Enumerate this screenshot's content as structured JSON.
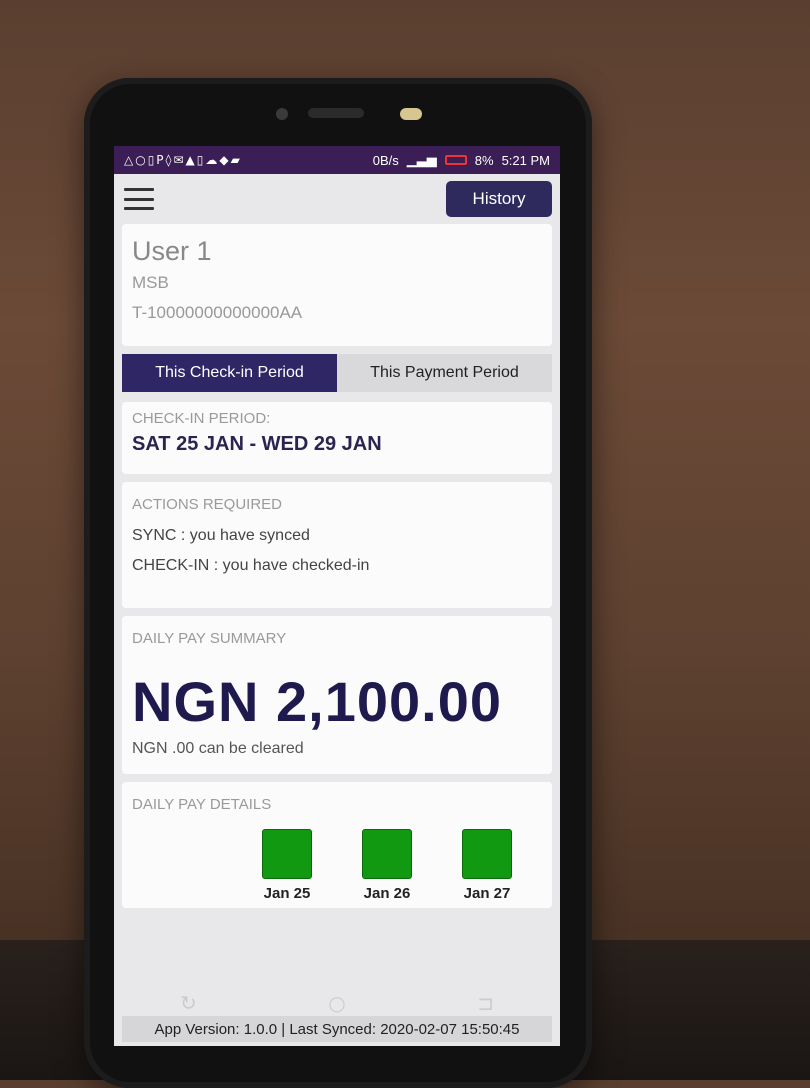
{
  "status_bar": {
    "network_speed": "0B/s",
    "battery": "8%",
    "time": "5:21 PM"
  },
  "header": {
    "history_label": "History"
  },
  "user": {
    "name": "User 1",
    "org": "MSB",
    "id": "T-10000000000000AA"
  },
  "tabs": [
    {
      "label": "This Check-in Period",
      "active": true
    },
    {
      "label": "This Payment Period",
      "active": false
    }
  ],
  "checkin": {
    "label": "CHECK-IN PERIOD:",
    "value": "SAT 25 JAN - WED 29 JAN"
  },
  "actions": {
    "label": "ACTIONS REQUIRED",
    "items": [
      "SYNC : you have synced",
      "CHECK-IN : you have checked-in"
    ]
  },
  "summary": {
    "label": "DAILY PAY SUMMARY",
    "amount": "NGN 2,100.00",
    "cleared": "NGN .00 can be cleared"
  },
  "details": {
    "label": "DAILY PAY DETAILS",
    "days": [
      {
        "label": "Jan 25",
        "color": "#119a11"
      },
      {
        "label": "Jan 26",
        "color": "#119a11"
      },
      {
        "label": "Jan 27",
        "color": "#119a11"
      }
    ]
  },
  "footer": {
    "text": "App Version: 1.0.0 | Last Synced: 2020-02-07 15:50:45"
  },
  "colors": {
    "accent": "#2e2665",
    "statusbar": "#3a1e55",
    "success": "#119a11"
  }
}
